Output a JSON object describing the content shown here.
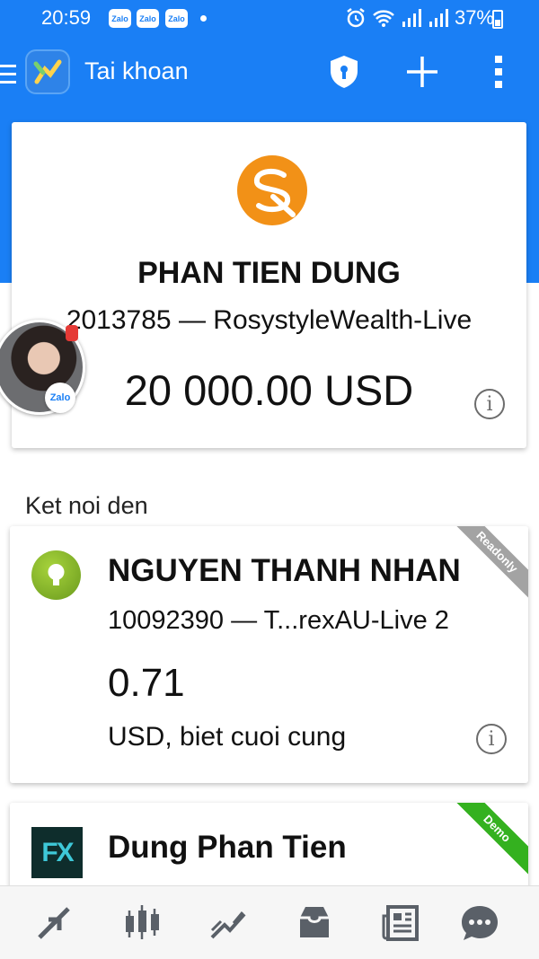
{
  "status_bar": {
    "time": "20:59",
    "notifications": [
      "Zalo",
      "Zalo",
      "Zalo"
    ],
    "battery": "37%"
  },
  "app_bar": {
    "title": "Tai khoan"
  },
  "main_account": {
    "name": "PHAN TIEN DUNG",
    "account_line": "2013785 — RosystyleWealth-Live",
    "balance": "20 000.00 USD"
  },
  "chat_head": {
    "app_label": "Zalo"
  },
  "section": {
    "label": "Ket noi den"
  },
  "accounts": [
    {
      "name": "NGUYEN THANH NHAN",
      "account_line": "10092390 — T...rexAU-Live 2",
      "balance": "0.71",
      "currency_note": "USD, biet cuoi cung",
      "ribbon": "Readonly"
    },
    {
      "name": "Dung Phan Tien",
      "ribbon": "Demo",
      "logo_text": "FX"
    }
  ],
  "bottom_nav": {
    "items": [
      "quotes-icon",
      "chart-icon",
      "trade-icon",
      "history-icon",
      "news-icon",
      "chat-icon"
    ]
  },
  "colors": {
    "primary": "#1a7ff5",
    "logo_orange": "#f29117",
    "ribbon_readonly": "#a3a3a3",
    "ribbon_demo": "#34b11f",
    "nav_icon": "#5a6068"
  }
}
